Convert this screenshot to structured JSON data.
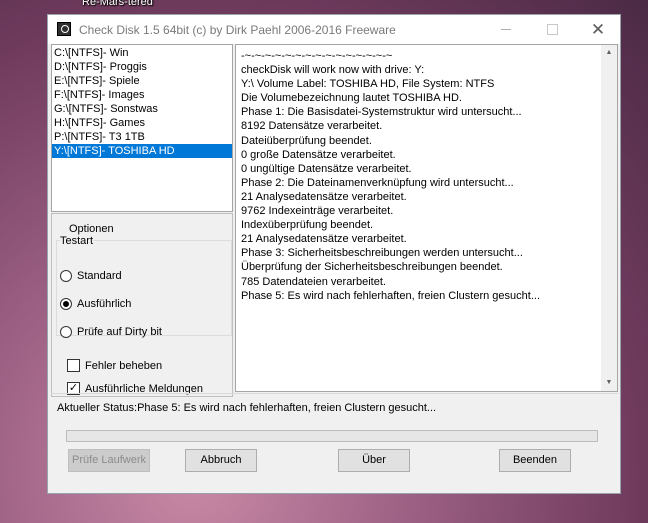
{
  "desktop": {
    "label": "Re-Mars-tered"
  },
  "window": {
    "title": "Check Disk 1.5 64bit (c) by Dirk Paehl  2006-2016 Freeware",
    "minimize_glyph": "—",
    "maximize_glyph": "☐",
    "close_glyph": "✕"
  },
  "drives": {
    "items": [
      {
        "label": "C:\\[NTFS]- Win"
      },
      {
        "label": "D:\\[NTFS]- Proggis"
      },
      {
        "label": "E:\\[NTFS]- Spiele"
      },
      {
        "label": "F:\\[NTFS]- Images"
      },
      {
        "label": "G:\\[NTFS]- Sonstwas"
      },
      {
        "label": "H:\\[NTFS]- Games"
      },
      {
        "label": "P:\\[NTFS]- T3 1TB"
      },
      {
        "label": "Y:\\[NTFS]- TOSHIBA HD"
      }
    ],
    "selected_index": 7
  },
  "options": {
    "title": "Optionen",
    "test_type": {
      "title": "Testart",
      "radios": [
        {
          "label": "Standard",
          "checked": false
        },
        {
          "label": "Ausführlich",
          "checked": true
        },
        {
          "label": "Prüfe auf Dirty bit",
          "checked": false
        }
      ]
    },
    "checkboxes": [
      {
        "label": "Fehler beheben",
        "checked": false
      },
      {
        "label": "Ausführliche Meldungen",
        "checked": true
      }
    ]
  },
  "log": {
    "lines": [
      "-~-~-~-~-~-~-~-~-~-~-~-~-~-~-~",
      "checkDisk will work now with drive: Y:",
      "Y:\\ Volume Label: TOSHIBA HD, File System: NTFS",
      "Die Volumebezeichnung lautet TOSHIBA HD.",
      "Phase 1: Die Basisdatei-Systemstruktur wird untersucht...",
      "8192 Datensätze verarbeitet.",
      "Dateiüberprüfung beendet.",
      "0 große Datensätze verarbeitet.",
      "0 ungültige Datensätze verarbeitet.",
      "Phase 2: Die Dateinamenverknüpfung wird untersucht...",
      "21 Analysedatensätze verarbeitet.",
      "9762 Indexeinträge verarbeitet.",
      "Indexüberprüfung beendet.",
      "21 Analysedatensätze verarbeitet.",
      "Phase 3: Sicherheitsbeschreibungen werden untersucht...",
      "Überprüfung der Sicherheitsbeschreibungen beendet.",
      "785 Datendateien verarbeitet.",
      "Phase 5: Es wird nach fehlerhaften, freien Clustern gesucht..."
    ]
  },
  "status": {
    "text": "Aktueller Status:Phase 5: Es wird nach fehlerhaften, freien Clustern gesucht...",
    "progress_fraction": 0.0
  },
  "buttons": {
    "check": "Prüfe Laufwerk",
    "abort": "Abbruch",
    "about": "Über",
    "exit": "Beenden"
  }
}
